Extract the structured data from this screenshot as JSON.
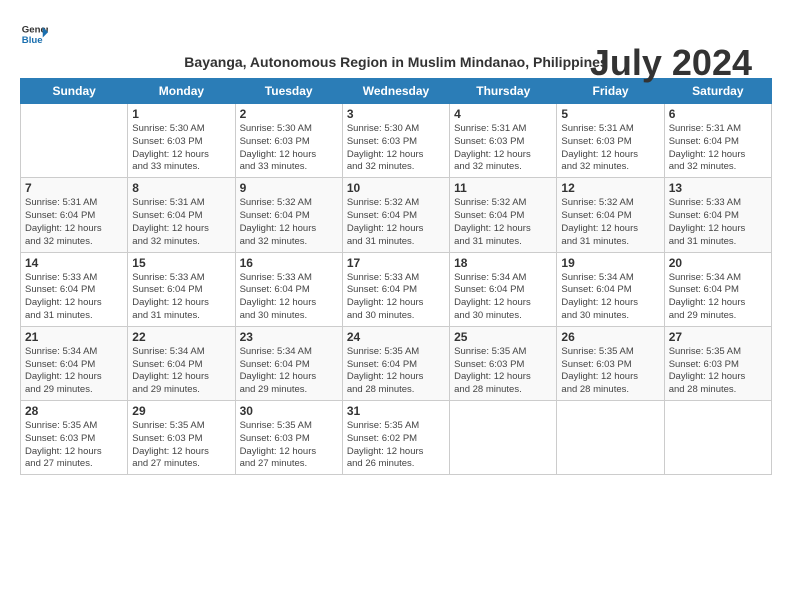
{
  "logo": {
    "line1": "General",
    "line2": "Blue"
  },
  "title": "July 2024",
  "subtitle": "Bayanga, Autonomous Region in Muslim Mindanao, Philippines",
  "days_of_week": [
    "Sunday",
    "Monday",
    "Tuesday",
    "Wednesday",
    "Thursday",
    "Friday",
    "Saturday"
  ],
  "weeks": [
    [
      {
        "num": "",
        "info": ""
      },
      {
        "num": "1",
        "info": "Sunrise: 5:30 AM\nSunset: 6:03 PM\nDaylight: 12 hours\nand 33 minutes."
      },
      {
        "num": "2",
        "info": "Sunrise: 5:30 AM\nSunset: 6:03 PM\nDaylight: 12 hours\nand 33 minutes."
      },
      {
        "num": "3",
        "info": "Sunrise: 5:30 AM\nSunset: 6:03 PM\nDaylight: 12 hours\nand 32 minutes."
      },
      {
        "num": "4",
        "info": "Sunrise: 5:31 AM\nSunset: 6:03 PM\nDaylight: 12 hours\nand 32 minutes."
      },
      {
        "num": "5",
        "info": "Sunrise: 5:31 AM\nSunset: 6:03 PM\nDaylight: 12 hours\nand 32 minutes."
      },
      {
        "num": "6",
        "info": "Sunrise: 5:31 AM\nSunset: 6:04 PM\nDaylight: 12 hours\nand 32 minutes."
      }
    ],
    [
      {
        "num": "7",
        "info": "Sunrise: 5:31 AM\nSunset: 6:04 PM\nDaylight: 12 hours\nand 32 minutes."
      },
      {
        "num": "8",
        "info": "Sunrise: 5:31 AM\nSunset: 6:04 PM\nDaylight: 12 hours\nand 32 minutes."
      },
      {
        "num": "9",
        "info": "Sunrise: 5:32 AM\nSunset: 6:04 PM\nDaylight: 12 hours\nand 32 minutes."
      },
      {
        "num": "10",
        "info": "Sunrise: 5:32 AM\nSunset: 6:04 PM\nDaylight: 12 hours\nand 31 minutes."
      },
      {
        "num": "11",
        "info": "Sunrise: 5:32 AM\nSunset: 6:04 PM\nDaylight: 12 hours\nand 31 minutes."
      },
      {
        "num": "12",
        "info": "Sunrise: 5:32 AM\nSunset: 6:04 PM\nDaylight: 12 hours\nand 31 minutes."
      },
      {
        "num": "13",
        "info": "Sunrise: 5:33 AM\nSunset: 6:04 PM\nDaylight: 12 hours\nand 31 minutes."
      }
    ],
    [
      {
        "num": "14",
        "info": "Sunrise: 5:33 AM\nSunset: 6:04 PM\nDaylight: 12 hours\nand 31 minutes."
      },
      {
        "num": "15",
        "info": "Sunrise: 5:33 AM\nSunset: 6:04 PM\nDaylight: 12 hours\nand 31 minutes."
      },
      {
        "num": "16",
        "info": "Sunrise: 5:33 AM\nSunset: 6:04 PM\nDaylight: 12 hours\nand 30 minutes."
      },
      {
        "num": "17",
        "info": "Sunrise: 5:33 AM\nSunset: 6:04 PM\nDaylight: 12 hours\nand 30 minutes."
      },
      {
        "num": "18",
        "info": "Sunrise: 5:34 AM\nSunset: 6:04 PM\nDaylight: 12 hours\nand 30 minutes."
      },
      {
        "num": "19",
        "info": "Sunrise: 5:34 AM\nSunset: 6:04 PM\nDaylight: 12 hours\nand 30 minutes."
      },
      {
        "num": "20",
        "info": "Sunrise: 5:34 AM\nSunset: 6:04 PM\nDaylight: 12 hours\nand 29 minutes."
      }
    ],
    [
      {
        "num": "21",
        "info": "Sunrise: 5:34 AM\nSunset: 6:04 PM\nDaylight: 12 hours\nand 29 minutes."
      },
      {
        "num": "22",
        "info": "Sunrise: 5:34 AM\nSunset: 6:04 PM\nDaylight: 12 hours\nand 29 minutes."
      },
      {
        "num": "23",
        "info": "Sunrise: 5:34 AM\nSunset: 6:04 PM\nDaylight: 12 hours\nand 29 minutes."
      },
      {
        "num": "24",
        "info": "Sunrise: 5:35 AM\nSunset: 6:04 PM\nDaylight: 12 hours\nand 28 minutes."
      },
      {
        "num": "25",
        "info": "Sunrise: 5:35 AM\nSunset: 6:03 PM\nDaylight: 12 hours\nand 28 minutes."
      },
      {
        "num": "26",
        "info": "Sunrise: 5:35 AM\nSunset: 6:03 PM\nDaylight: 12 hours\nand 28 minutes."
      },
      {
        "num": "27",
        "info": "Sunrise: 5:35 AM\nSunset: 6:03 PM\nDaylight: 12 hours\nand 28 minutes."
      }
    ],
    [
      {
        "num": "28",
        "info": "Sunrise: 5:35 AM\nSunset: 6:03 PM\nDaylight: 12 hours\nand 27 minutes."
      },
      {
        "num": "29",
        "info": "Sunrise: 5:35 AM\nSunset: 6:03 PM\nDaylight: 12 hours\nand 27 minutes."
      },
      {
        "num": "30",
        "info": "Sunrise: 5:35 AM\nSunset: 6:03 PM\nDaylight: 12 hours\nand 27 minutes."
      },
      {
        "num": "31",
        "info": "Sunrise: 5:35 AM\nSunset: 6:02 PM\nDaylight: 12 hours\nand 26 minutes."
      },
      {
        "num": "",
        "info": ""
      },
      {
        "num": "",
        "info": ""
      },
      {
        "num": "",
        "info": ""
      }
    ]
  ],
  "row_styles": [
    "row-white",
    "row-alt",
    "row-white",
    "row-alt",
    "row-white"
  ]
}
